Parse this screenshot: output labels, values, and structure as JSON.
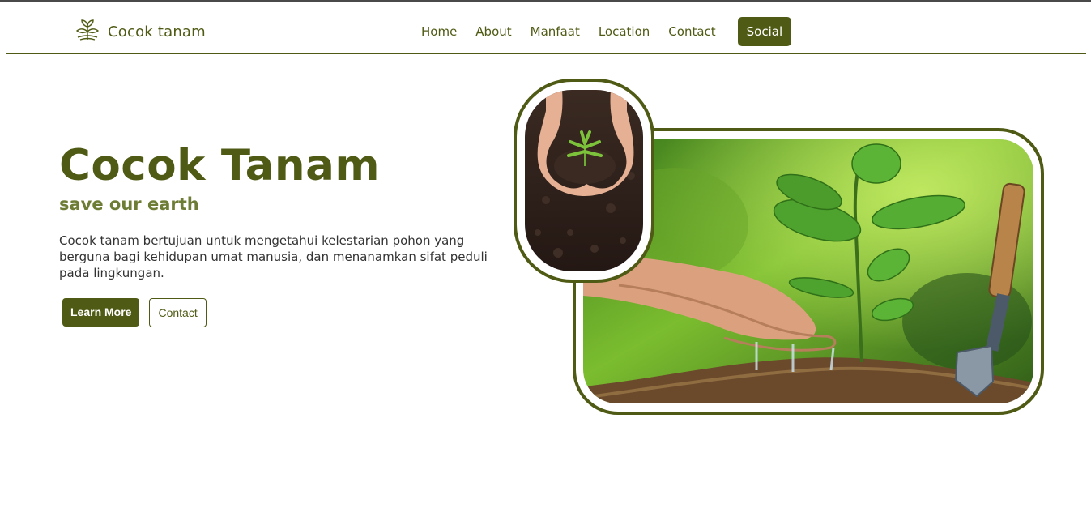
{
  "navbar": {
    "brand_name": "Cocok tanam",
    "brand_icon": "sprout-icon",
    "links": [
      {
        "label": "Home"
      },
      {
        "label": "About"
      },
      {
        "label": "Manfaat"
      },
      {
        "label": "Location"
      },
      {
        "label": "Contact"
      }
    ],
    "social_label": "Social"
  },
  "hero": {
    "title": "Cocok Tanam",
    "subtitle": "save our earth",
    "description": "Cocok tanam bertujuan untuk mengetahui kelestarian pohon yang berguna bagi kehidupan umat manusia, dan menanamkan sifat peduli pada lingkungan.",
    "learn_more_label": "Learn More",
    "contact_label": "Contact"
  },
  "colors": {
    "brand_green": "#4f5b14",
    "subtitle_green": "#6e7d35",
    "text_dark": "#333333"
  }
}
